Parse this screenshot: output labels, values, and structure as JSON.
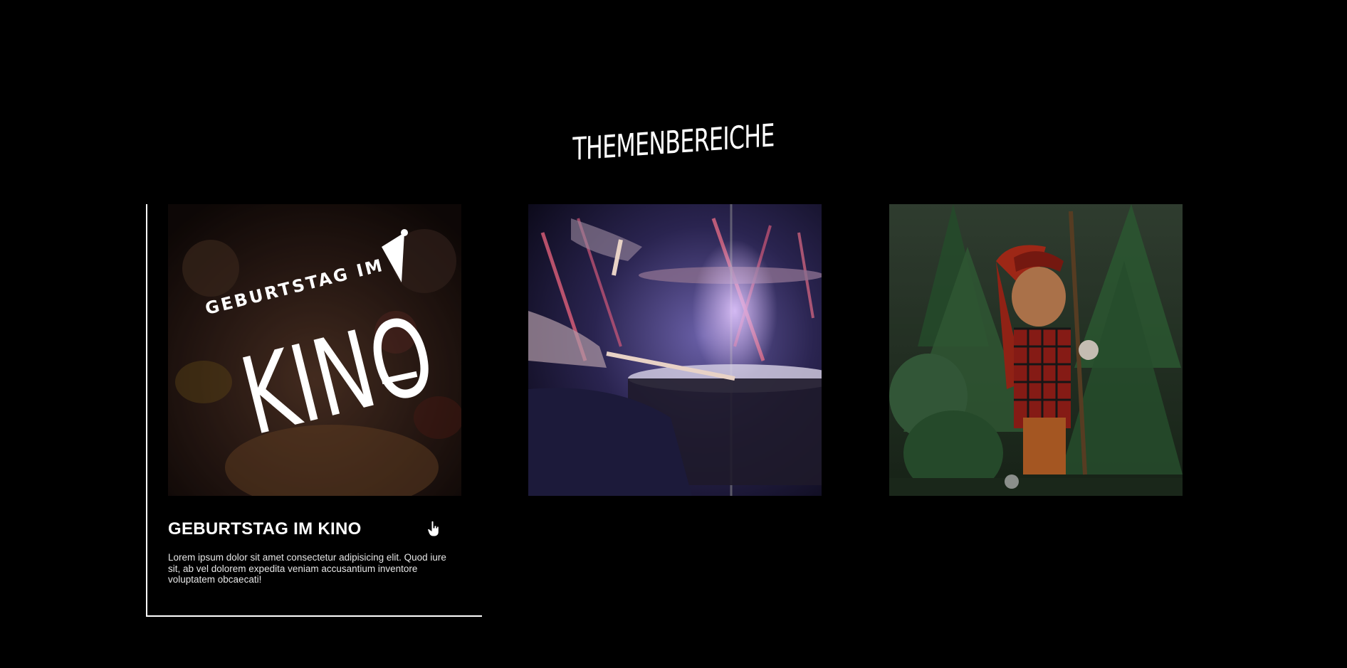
{
  "section": {
    "title": "THEMENBEREICHE"
  },
  "cards": [
    {
      "image_label": "Geburtstag im Kino",
      "logo_line1": "GEBURTSTAG IM",
      "logo_line2": "KINO",
      "title": "GEBURTSTAG IM KINO",
      "description": "Lorem ipsum dolor sit amet consectetur adipisicing elit. Quod iure sit, ab vel dolorem expedita veniam accusantium inventore voluptatem obcaecati!"
    },
    {
      "image_label": "drummer"
    },
    {
      "image_label": "puppet"
    }
  ],
  "colors": {
    "background": "#000000",
    "text": "#ffffff"
  }
}
